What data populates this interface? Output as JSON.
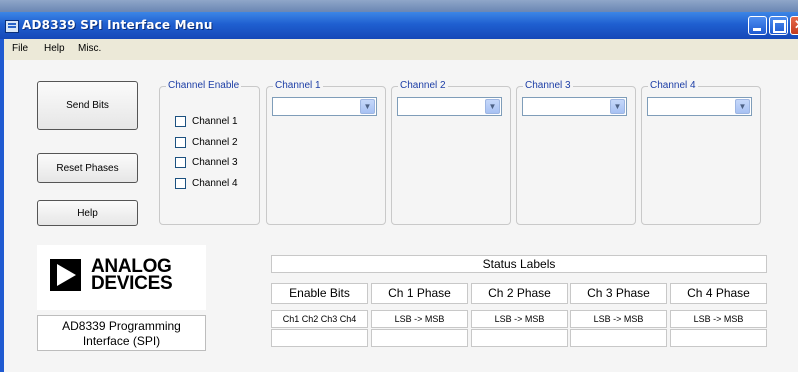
{
  "window": {
    "title": "AD8339 SPI Interface Menu"
  },
  "menu": [
    "File",
    "Help",
    "Misc."
  ],
  "buttons": {
    "send_bits": "Send Bits",
    "reset_phases": "Reset Phases",
    "help": "Help"
  },
  "channel_enable": {
    "title": "Channel Enable",
    "channels": [
      "Channel 1",
      "Channel 2",
      "Channel 3",
      "Channel 4"
    ]
  },
  "channel_groups": [
    {
      "title": "Channel 1",
      "value": ""
    },
    {
      "title": "Channel 2",
      "value": ""
    },
    {
      "title": "Channel 3",
      "value": ""
    },
    {
      "title": "Channel 4",
      "value": ""
    }
  ],
  "logo": {
    "line1": "ANALOG",
    "line2": "DEVICES"
  },
  "program_label": {
    "line1": "AD8339 Programming",
    "line2": "Interface (SPI)"
  },
  "status": {
    "title": "Status Labels",
    "headers": [
      "Enable Bits",
      "Ch 1 Phase",
      "Ch 2 Phase",
      "Ch 3 Phase",
      "Ch 4 Phase"
    ],
    "values": [
      "Ch1 Ch2 Ch3 Ch4",
      "LSB -> MSB",
      "LSB -> MSB",
      "LSB -> MSB",
      "LSB -> MSB"
    ],
    "values2": [
      "",
      "",
      "",
      "",
      ""
    ]
  },
  "colors": {
    "titlebar": "#1f5fd0",
    "group_title": "#1d3ea6",
    "background": "#f5f5f5"
  },
  "icons": {
    "app": "app-window-icon",
    "dropdown": "chevron-down-icon"
  }
}
